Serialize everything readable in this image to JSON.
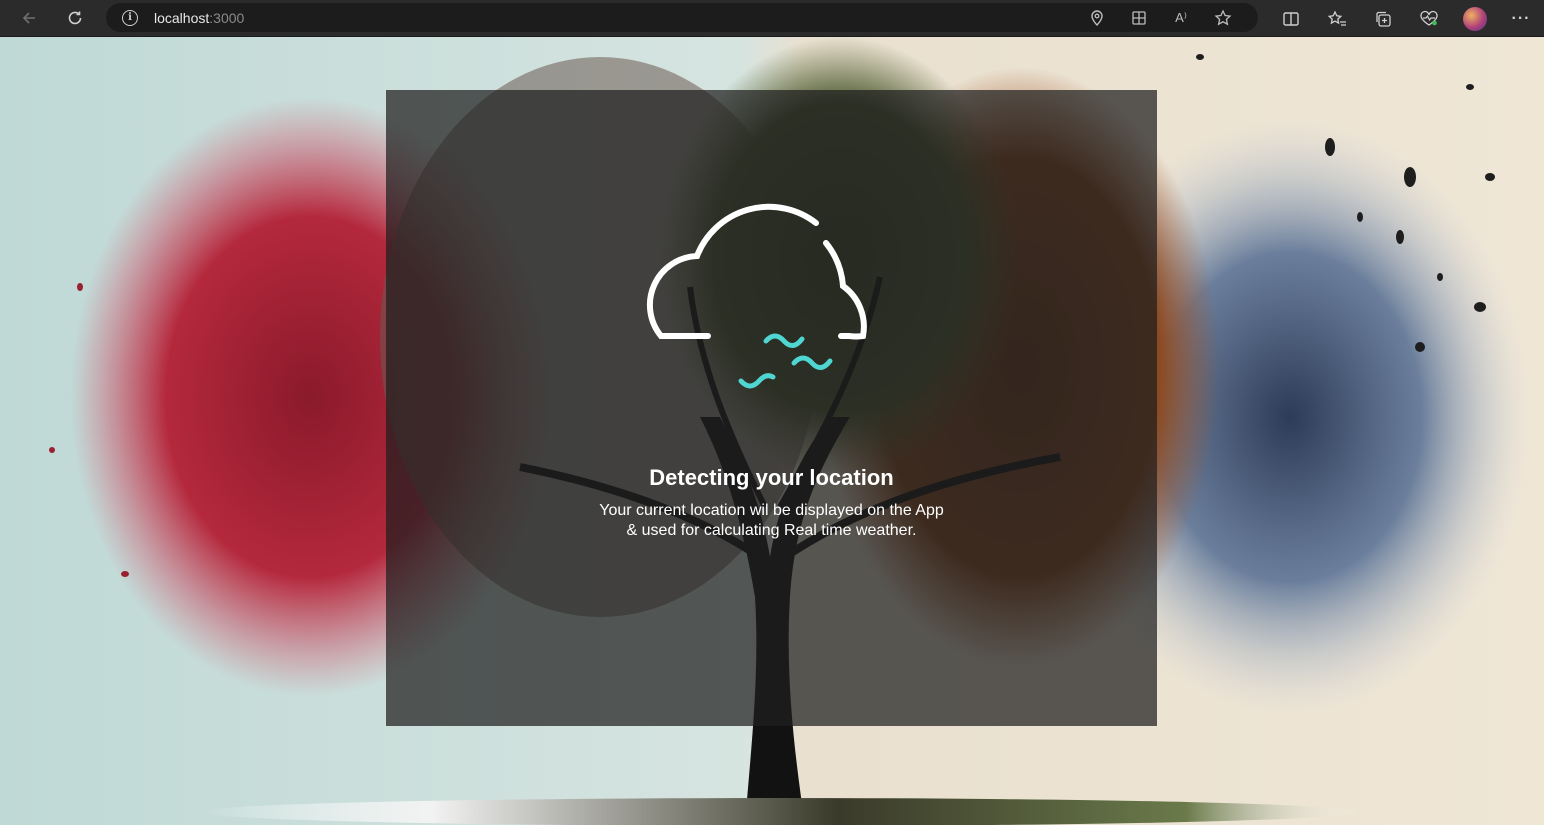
{
  "browser": {
    "url_host": "localhost",
    "url_port": ":3000",
    "icons": {
      "back": "back-arrow-icon",
      "reload": "reload-icon",
      "site_info": "info-icon",
      "location": "location-pin-icon",
      "apps": "apps-icon",
      "read_aloud": "read-aloud-icon",
      "favorite": "star-icon",
      "split_screen": "split-screen-icon",
      "favorites": "favorites-list-icon",
      "collections": "collections-icon",
      "health": "browser-essentials-icon",
      "profile": "avatar",
      "more": "more-icon"
    },
    "read_aloud_glyph": "A⁾",
    "info_glyph": "i",
    "more_glyph": "···"
  },
  "app": {
    "title": "Detecting your location",
    "description_line1": "Your current location wil be displayed on the App",
    "description_line2": "& used for calculating Real time weather.",
    "accent_color": "#4fd6d2",
    "card_color": "#1e1e1e"
  }
}
